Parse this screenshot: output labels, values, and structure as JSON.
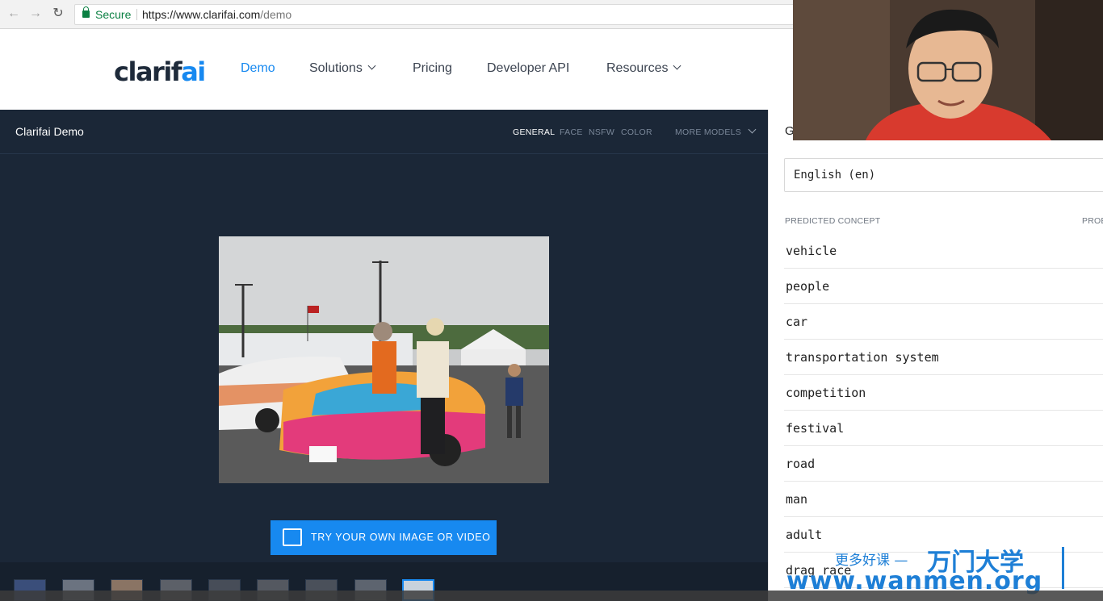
{
  "browser": {
    "secure_label": "Secure",
    "url_base": "https://www.clarifai.com",
    "url_path": "/demo"
  },
  "site": {
    "logo_main": "clarif",
    "logo_accent": "ai",
    "nav": {
      "demo": "Demo",
      "solutions": "Solutions",
      "pricing": "Pricing",
      "developer_api": "Developer API",
      "resources": "Resources"
    }
  },
  "demo": {
    "title": "Clarifai Demo",
    "models": {
      "general": "GENERAL",
      "face": "FACE",
      "nsfw": "NSFW",
      "color": "COLOR",
      "more": "MORE MODELS"
    },
    "try_button": "TRY YOUR OWN IMAGE OR VIDEO"
  },
  "panel": {
    "heading_letter": "G",
    "language": "English (en)",
    "col_concept": "PREDICTED CONCEPT",
    "col_prob": "PROB",
    "concepts": [
      "vehicle",
      "people",
      "car",
      "transportation system",
      "competition",
      "festival",
      "road",
      "man",
      "adult",
      "drag race"
    ]
  },
  "watermark": {
    "cn_small": "更多好课 —",
    "cn_big": "万门大学",
    "url": "www.wanmen.org"
  },
  "colors": {
    "accent": "#1789f0",
    "demo_bg": "#1b2737",
    "secure": "#0b8043"
  }
}
